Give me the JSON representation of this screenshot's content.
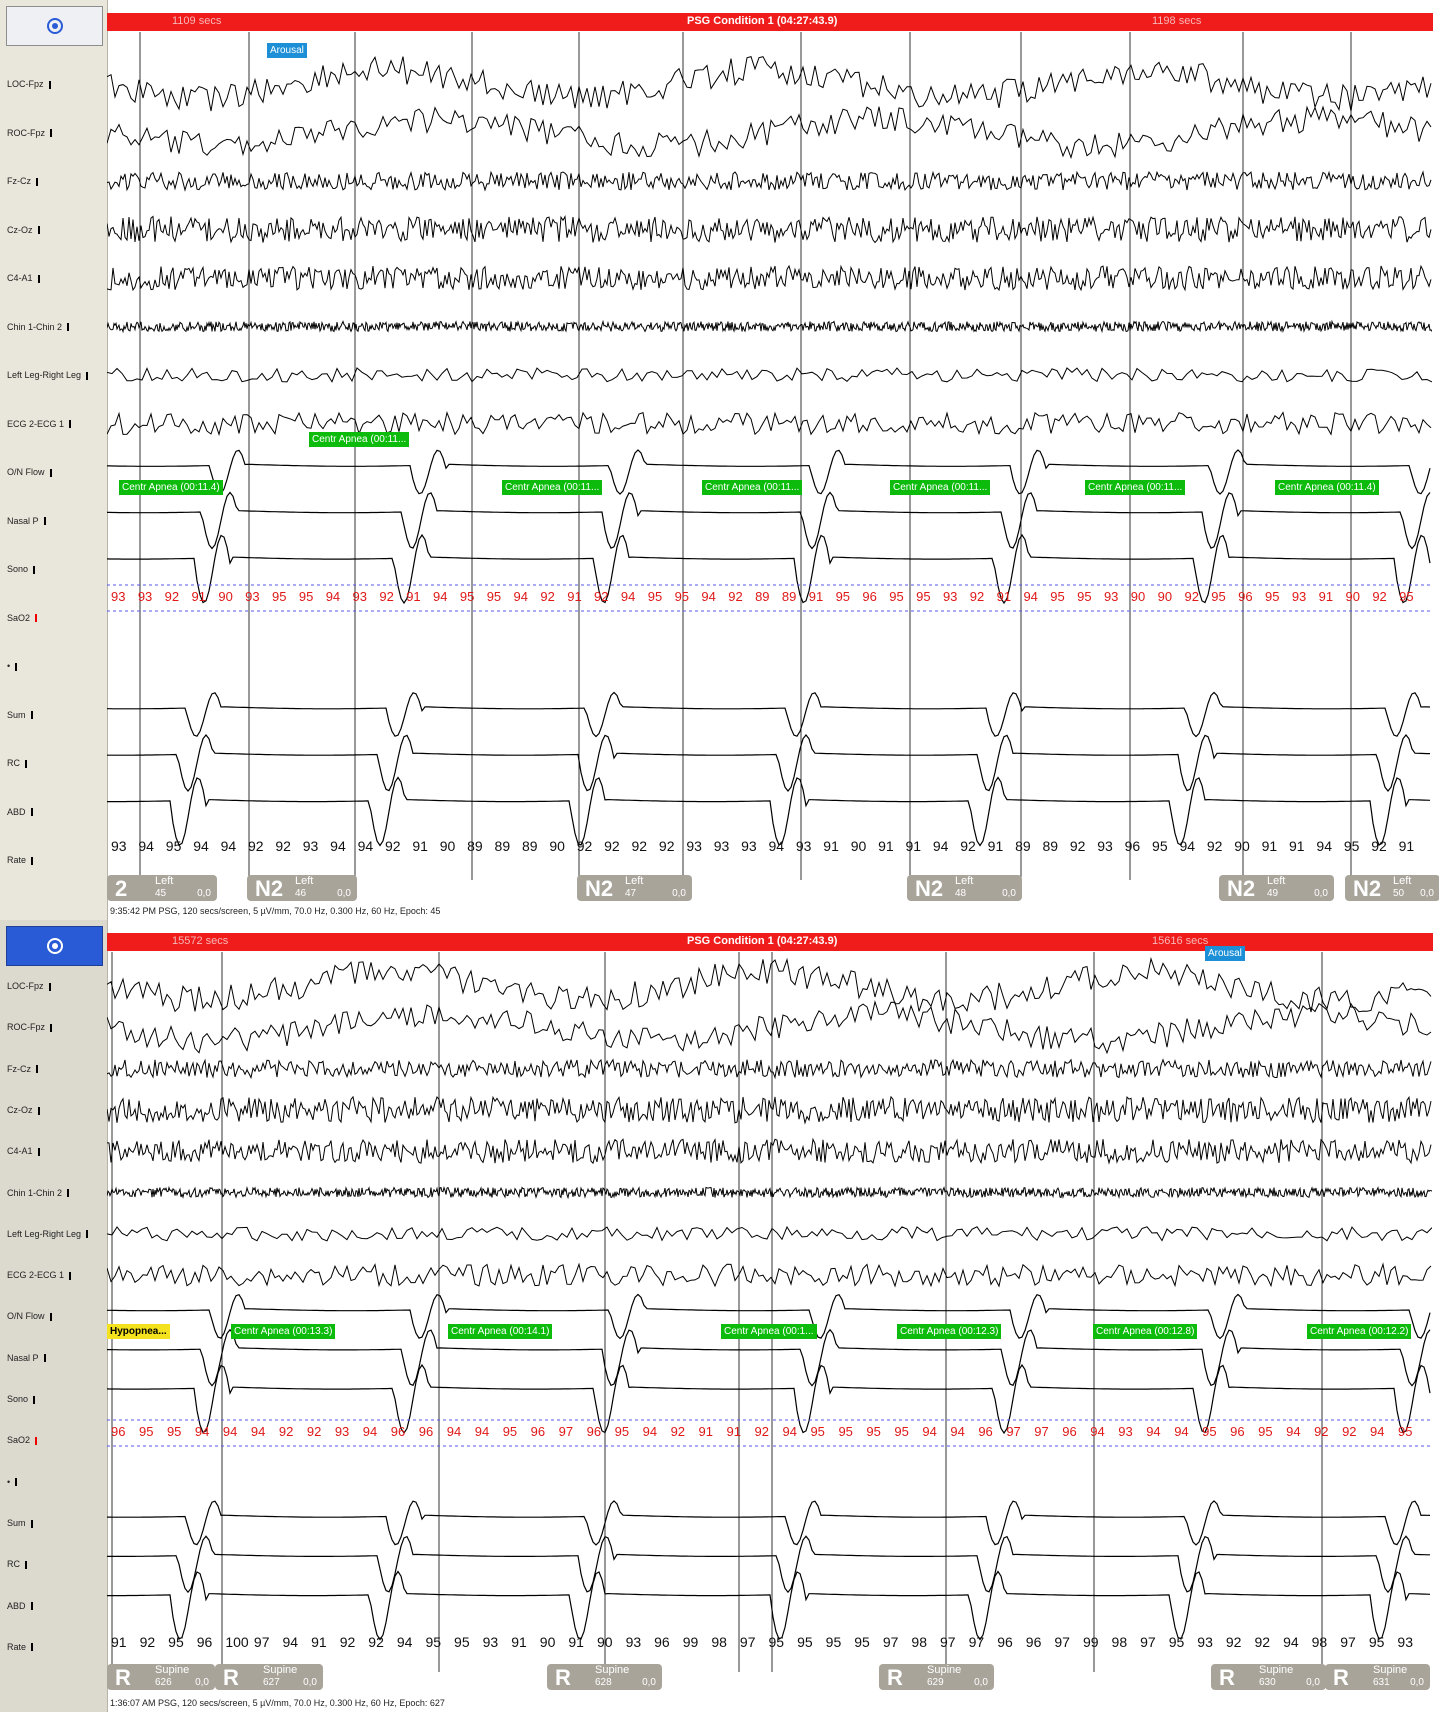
{
  "colors": {
    "header": "#f01b1b",
    "apnea": "#0dbb0d",
    "arousal": "#1c8fd6",
    "hypopnea": "#f4e21e",
    "spo2": "#e01818",
    "stage_badge": "#a8a49a"
  },
  "panels": [
    {
      "icon": "target-icon",
      "header": {
        "left": "1109 secs",
        "center": "PSG Condition 1 (04:27:43.9)",
        "right": "1198 secs"
      },
      "channels": [
        "LOC-Fpz",
        "ROC-Fpz",
        "Fz-Cz",
        "Cz-Oz",
        "C4-A1",
        "Chin 1-Chin 2",
        "Left Leg-Right Leg",
        "ECG 2-ECG 1",
        "O/N Flow",
        "Nasal P",
        "Sono",
        "SaO2",
        "•",
        "Sum",
        "RC",
        "ABD",
        "Rate"
      ],
      "events": [
        {
          "type": "arousal",
          "label": "Arousal"
        },
        {
          "type": "apnea",
          "label": "Centr Apnea (00:11..."
        },
        {
          "type": "apnea",
          "label": "Centr Apnea (00:11.4)"
        },
        {
          "type": "apnea",
          "label": "Centr Apnea (00:11..."
        },
        {
          "type": "apnea",
          "label": "Centr Apnea (00:11..."
        },
        {
          "type": "apnea",
          "label": "Centr Apnea (00:11..."
        },
        {
          "type": "apnea",
          "label": "Centr Apnea (00:11..."
        },
        {
          "type": "apnea",
          "label": "Centr Apnea (00:11.4)"
        }
      ],
      "spo2": [
        "93",
        "93",
        "92",
        "91",
        "90",
        "93",
        "95",
        "95",
        "94",
        "93",
        "92",
        "91",
        "94",
        "95",
        "95",
        "94",
        "92",
        "91",
        "92",
        "94",
        "95",
        "95",
        "94",
        "92",
        "89",
        "89",
        "91",
        "95",
        "96",
        "95",
        "95",
        "93",
        "92",
        "91",
        "94",
        "95",
        "95",
        "93",
        "90",
        "90",
        "92",
        "95",
        "96",
        "95",
        "93",
        "91",
        "90",
        "92",
        "95"
      ],
      "rate": [
        "93",
        "94",
        "95",
        "94",
        "94",
        "92",
        "92",
        "93",
        "94",
        "94",
        "92",
        "91",
        "90",
        "89",
        "89",
        "89",
        "90",
        "92",
        "92",
        "92",
        "92",
        "93",
        "93",
        "93",
        "94",
        "93",
        "91",
        "90",
        "91",
        "91",
        "94",
        "92",
        "91",
        "89",
        "89",
        "92",
        "93",
        "96",
        "95",
        "94",
        "92",
        "90",
        "91",
        "91",
        "94",
        "95",
        "92",
        "91"
      ],
      "stages": [
        {
          "stage": "2",
          "pos": "Left",
          "epoch": "45",
          "val": "0,0"
        },
        {
          "stage": "N2",
          "pos": "Left",
          "epoch": "46",
          "val": "0,0"
        },
        {
          "stage": "N2",
          "pos": "Left",
          "epoch": "47",
          "val": "0,0"
        },
        {
          "stage": "N2",
          "pos": "Left",
          "epoch": "48",
          "val": "0,0"
        },
        {
          "stage": "N2",
          "pos": "Left",
          "epoch": "49",
          "val": "0,0"
        },
        {
          "stage": "N2",
          "pos": "Left",
          "epoch": "50",
          "val": "0,0"
        }
      ],
      "footer": "9:35:42 PM PSG, 120 secs/screen, 5 µV/mm, 70.0 Hz, 0.300 Hz, 60 Hz, Epoch: 45"
    },
    {
      "icon": "target-icon",
      "header": {
        "left": "15572 secs",
        "center": "PSG Condition 1 (04:27:43.9)",
        "right": "15616 secs"
      },
      "channels": [
        "LOC-Fpz",
        "ROC-Fpz",
        "Fz-Cz",
        "Cz-Oz",
        "C4-A1",
        "Chin 1-Chin 2",
        "Left Leg-Right Leg",
        "ECG 2-ECG 1",
        "O/N Flow",
        "Nasal P",
        "Sono",
        "SaO2",
        "•",
        "Sum",
        "RC",
        "ABD",
        "Rate"
      ],
      "events": [
        {
          "type": "arousal",
          "label": "Arousal"
        },
        {
          "type": "hypop",
          "label": "Hypopnea..."
        },
        {
          "type": "apnea",
          "label": "Centr Apnea (00:13.3)"
        },
        {
          "type": "apnea",
          "label": "Centr Apnea (00:14.1)"
        },
        {
          "type": "apnea",
          "label": "Centr Apnea (00:1..."
        },
        {
          "type": "apnea",
          "label": "Centr Apnea (00:12.3)"
        },
        {
          "type": "apnea",
          "label": "Centr Apnea (00:12.8)"
        },
        {
          "type": "apnea",
          "label": "Centr Apnea (00:12.2)"
        }
      ],
      "spo2": [
        "96",
        "95",
        "95",
        "94",
        "94",
        "94",
        "92",
        "92",
        "93",
        "94",
        "96",
        "96",
        "94",
        "94",
        "95",
        "96",
        "97",
        "96",
        "95",
        "94",
        "92",
        "91",
        "91",
        "92",
        "94",
        "95",
        "95",
        "95",
        "95",
        "94",
        "94",
        "96",
        "97",
        "97",
        "96",
        "94",
        "93",
        "94",
        "94",
        "95",
        "96",
        "95",
        "94",
        "92",
        "92",
        "94",
        "95"
      ],
      "rate": [
        "91",
        "92",
        "95",
        "96",
        "100",
        "97",
        "94",
        "91",
        "92",
        "92",
        "94",
        "95",
        "95",
        "93",
        "91",
        "90",
        "91",
        "90",
        "93",
        "96",
        "99",
        "98",
        "97",
        "95",
        "95",
        "95",
        "95",
        "97",
        "98",
        "97",
        "97",
        "96",
        "96",
        "97",
        "99",
        "98",
        "97",
        "95",
        "93",
        "92",
        "92",
        "94",
        "98",
        "97",
        "95",
        "93"
      ],
      "stages": [
        {
          "stage": "R",
          "pos": "Supine",
          "epoch": "626",
          "val": "0,0"
        },
        {
          "stage": "R",
          "pos": "Supine",
          "epoch": "627",
          "val": "0,0"
        },
        {
          "stage": "R",
          "pos": "Supine",
          "epoch": "628",
          "val": "0,0"
        },
        {
          "stage": "R",
          "pos": "Supine",
          "epoch": "629",
          "val": "0,0"
        },
        {
          "stage": "R",
          "pos": "Supine",
          "epoch": "630",
          "val": "0,0"
        },
        {
          "stage": "R",
          "pos": "Supine",
          "epoch": "631",
          "val": "0,0"
        }
      ],
      "footer": "1:36:07 AM PSG, 120 secs/screen, 5 µV/mm, 70.0 Hz, 0.300 Hz, 60 Hz, Epoch: 627"
    }
  ]
}
